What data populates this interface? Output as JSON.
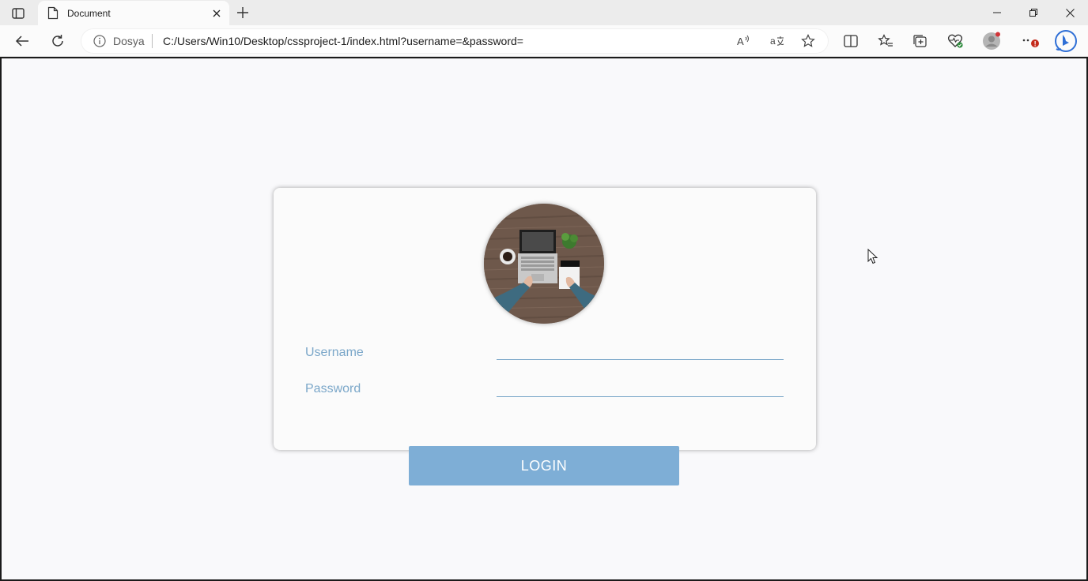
{
  "browser": {
    "tab_title": "Document",
    "site_label": "Dosya",
    "url": "C:/Users/Win10/Desktop/cssproject-1/index.html?username=&password="
  },
  "login": {
    "username_label": "Username",
    "username_value": "",
    "password_label": "Password",
    "password_value": "",
    "button_label": "LOGIN"
  },
  "colors": {
    "accent": "#7ba7c9",
    "button": "#7eaed6",
    "card_bg": "#fbfbfb",
    "page_bg": "#f9f9fb"
  }
}
